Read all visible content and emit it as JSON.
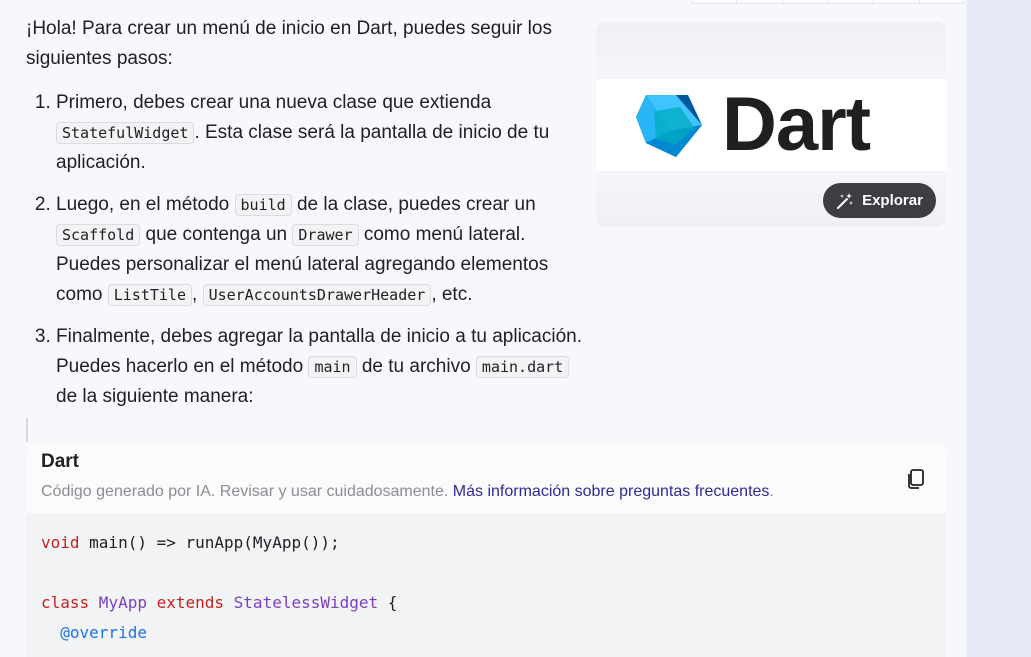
{
  "answer": {
    "intro": "¡Hola! Para crear un menú de inicio en Dart, puedes seguir los siguientes pasos:",
    "steps": [
      {
        "p1": "Primero, debes crear una nueva clase que extienda ",
        "code1": "StatefulWidget",
        "p2": ". Esta clase será la pantalla de inicio de tu aplicación."
      },
      {
        "p1": "Luego, en el método ",
        "code1": "build",
        "p2": " de la clase, puedes crear un ",
        "code2": "Scaffold",
        "p3": " que contenga un ",
        "code3": "Drawer",
        "p4": " como menú lateral. Puedes personalizar el menú lateral agregando elementos como ",
        "code4": "ListTile",
        "p5": ", ",
        "code5": "UserAccountsDrawerHeader",
        "p6": ", etc."
      },
      {
        "p1": "Finalmente, debes agregar la pantalla de inicio a tu aplicación. Puedes hacerlo en el método ",
        "code1": "main",
        "p2": " de tu archivo ",
        "code2": "main.dart",
        "p3": " de la siguiente manera:"
      }
    ]
  },
  "image_card": {
    "logo_text": "Dart",
    "explore_label": "Explorar",
    "explore_icon": "magic-wand-icon"
  },
  "code_block": {
    "language": "Dart",
    "note": "Código generado por IA. Revisar y usar cuidadosamente.",
    "note_link": "Más información sobre preguntas frecuentes",
    "note_end": ".",
    "copy_icon": "copy-icon",
    "lines": [
      {
        "kw": "void",
        "rest": " main() => runApp(MyApp());"
      },
      {
        "kw": "class",
        "cls": " MyApp",
        "kw2": " extends",
        "cls2": " StatelessWidget",
        "rest": " {"
      },
      {
        "ann": "@override"
      }
    ]
  },
  "colors": {
    "keyword": "#c5221f",
    "class_name": "#7b3fbf",
    "annotation": "#1a73e8",
    "link": "#2f2b8f",
    "dart_teal_light": "#40c4ff",
    "dart_teal_dark": "#01579b"
  }
}
